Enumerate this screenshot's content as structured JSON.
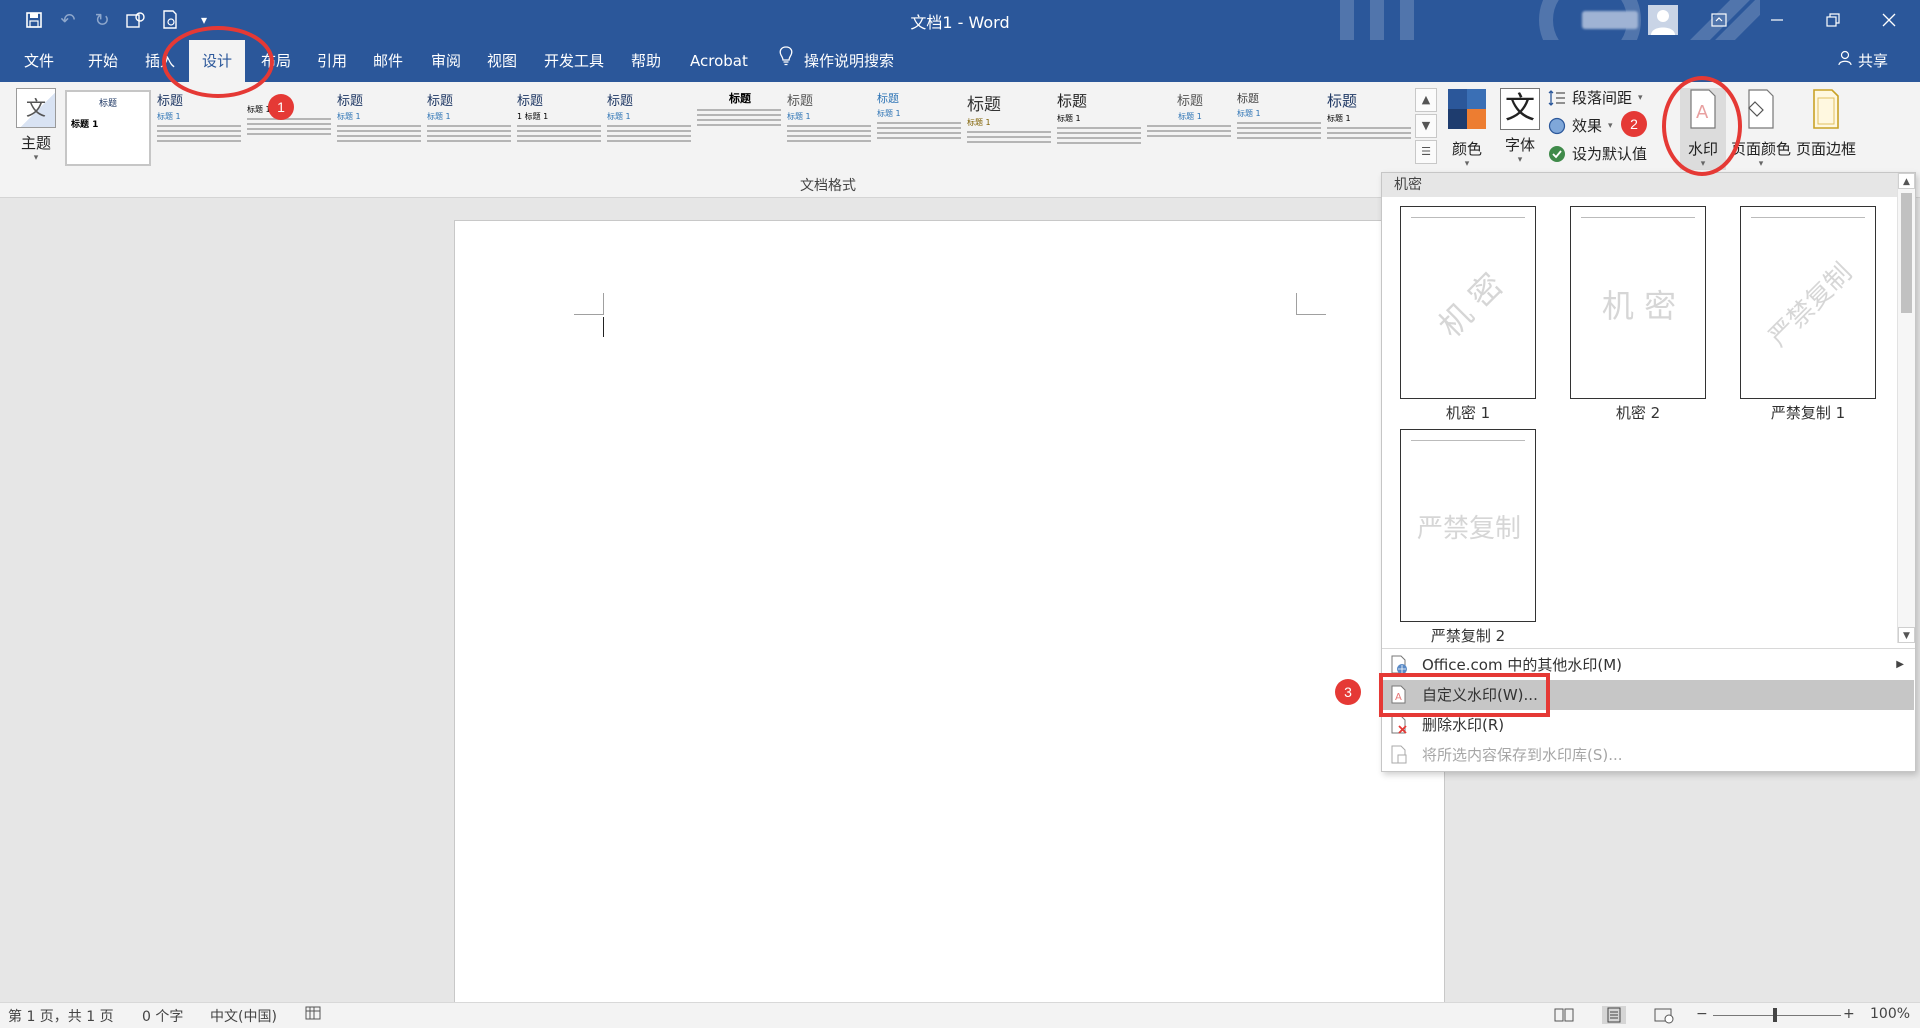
{
  "window": {
    "title": "文档1  -  Word",
    "qat_icons": [
      "save-icon",
      "undo-icon",
      "redo-icon",
      "touch-mode-icon",
      "print-preview-icon",
      "customize-qat-icon"
    ],
    "window_buttons": [
      "ribbon-display-options-icon",
      "minimize-icon",
      "restore-icon",
      "close-icon"
    ]
  },
  "tabs": {
    "items": [
      {
        "label": "文件"
      },
      {
        "label": "开始"
      },
      {
        "label": "插入"
      },
      {
        "label": "设计",
        "active": true
      },
      {
        "label": "布局"
      },
      {
        "label": "引用"
      },
      {
        "label": "邮件"
      },
      {
        "label": "审阅"
      },
      {
        "label": "视图"
      },
      {
        "label": "开发工具"
      },
      {
        "label": "帮助"
      },
      {
        "label": "Acrobat"
      }
    ],
    "search_label": "操作说明搜索",
    "share_label": "共享"
  },
  "ribbon": {
    "theme_label": "主题",
    "theme_icon_char": "文",
    "style_gallery": [
      {
        "head": "标题",
        "sub": "标题 1"
      },
      {
        "head": "标题",
        "sub": "标题 1"
      },
      {
        "head": "",
        "sub": "标题 1"
      },
      {
        "head": "标题",
        "sub": "标题 1"
      },
      {
        "head": "标题",
        "sub": "标题 1"
      },
      {
        "head": "标题",
        "sub": "1  标题 1"
      },
      {
        "head": "标题",
        "sub": "标题 1"
      },
      {
        "head": "标题",
        "sub": ""
      },
      {
        "head": "标题",
        "sub": "标题 1"
      },
      {
        "head": "标题",
        "sub": "标题 1"
      },
      {
        "head": "标题",
        "sub": "标题 1"
      },
      {
        "head": "标题",
        "sub": "标题 1"
      },
      {
        "head": "标题",
        "sub": "标题 1"
      },
      {
        "head": "标题",
        "sub": "标题 1"
      },
      {
        "head": "标题",
        "sub": "标题 1"
      }
    ],
    "group_label": "文档格式",
    "colors_label": "颜色",
    "fonts_label": "字体",
    "fonts_icon_char": "文",
    "paragraph_spacing_label": "段落间距",
    "effects_label": "效果",
    "set_default_label": "设为默认值",
    "watermark_label": "水印",
    "page_color_label": "页面颜色",
    "page_borders_label": "页面边框"
  },
  "annotations": {
    "badge1": "1",
    "badge2": "2",
    "badge3": "3",
    "color": "#e53935"
  },
  "watermark_menu": {
    "category": "机密",
    "thumbnails": [
      {
        "text": "机 密",
        "caption": "机密 1",
        "rotated": true
      },
      {
        "text": "机 密",
        "caption": "机密 2",
        "rotated": false
      },
      {
        "text": "严禁复制",
        "caption": "严禁复制 1",
        "rotated": true
      },
      {
        "text": "严禁复制",
        "caption": "严禁复制 2",
        "rotated": false
      }
    ],
    "items": [
      {
        "label": "Office.com 中的其他水印(M)",
        "has_submenu": true,
        "enabled": true
      },
      {
        "label": "自定义水印(W)...",
        "highlighted": true,
        "enabled": true
      },
      {
        "label": "删除水印(R)",
        "enabled": true
      },
      {
        "label": "将所选内容保存到水印库(S)...",
        "enabled": false
      }
    ]
  },
  "status_bar": {
    "page_info": "第 1 页，共 1 页",
    "word_count": "0 个字",
    "language": "中文(中国)",
    "zoom": "100%",
    "zoom_minus": "−",
    "zoom_plus": "+"
  },
  "colors": {
    "brand": "#2b579a",
    "ribbon_bg": "#f3f3f3",
    "highlight": "#c6c6c6"
  }
}
